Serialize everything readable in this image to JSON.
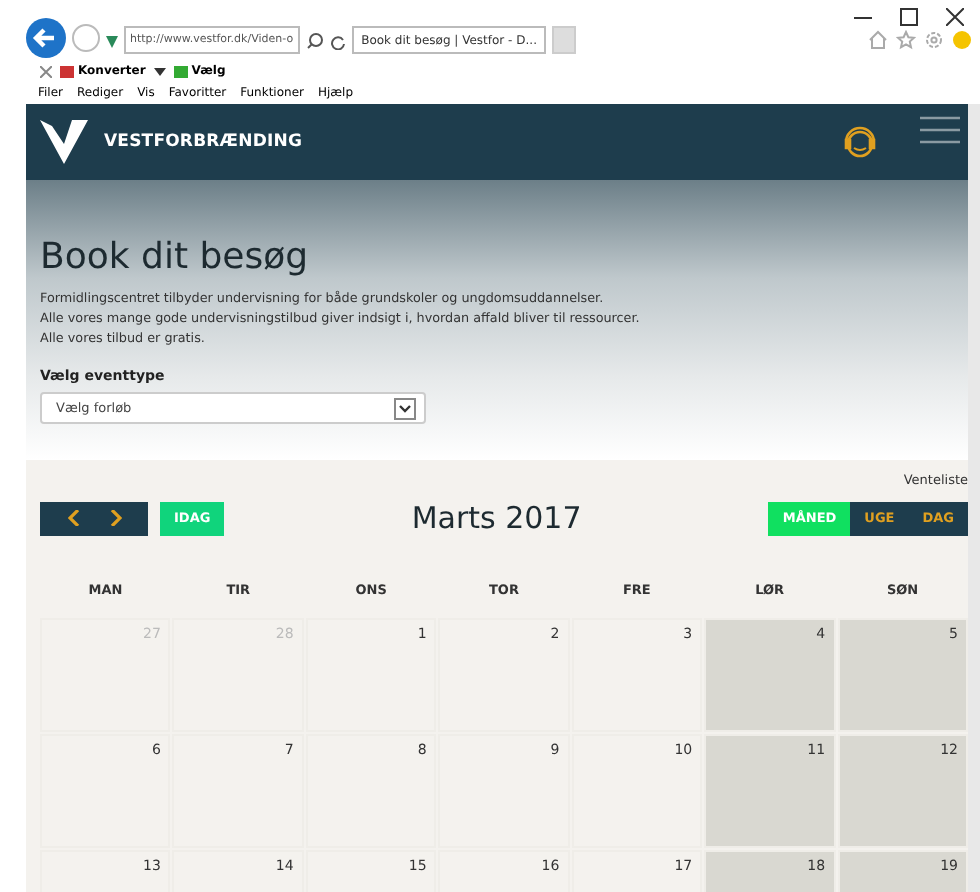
{
  "browser": {
    "address": "http://www.vestfor.dk/Viden-o",
    "tabs": [
      {
        "label": "Book dit besøg | Vestfor - D...",
        "selected": true
      }
    ],
    "toolbar": [
      {
        "label": "Konverter"
      },
      {
        "label": "Vælg"
      }
    ],
    "menu": [
      "Filer",
      "Rediger",
      "Vis",
      "Favoritter",
      "Funktioner",
      "Hjælp"
    ]
  },
  "header": {
    "brand": "VESTFORBRÆNDING"
  },
  "hero": {
    "title": "Book dit besøg",
    "lines": [
      "Formidlingscentret tilbyder undervisning for både grundskoler og ungdomsuddannelser.",
      "Alle vores mange gode undervisningstilbud giver indsigt i, hvordan affald bliver til ressourcer.",
      "Alle vores tilbud er gratis."
    ]
  },
  "filter": {
    "label": "Vælg eventtype",
    "value": "Vælg forløb"
  },
  "calendar": {
    "waitlist": "Venteliste",
    "today": "IDAG",
    "title": "Marts 2017",
    "views": [
      {
        "label": "MÅNED",
        "selected": true
      },
      {
        "label": "UGE",
        "selected": false
      },
      {
        "label": "DAG",
        "selected": false
      }
    ],
    "columns": [
      {
        "label": "MAN",
        "weekend": false
      },
      {
        "label": "TIR",
        "weekend": false
      },
      {
        "label": "ONS",
        "weekend": false
      },
      {
        "label": "TOR",
        "weekend": false
      },
      {
        "label": "FRE",
        "weekend": false
      },
      {
        "label": "LØR",
        "weekend": true
      },
      {
        "label": "SØN",
        "weekend": true
      }
    ],
    "weeks": [
      [
        {
          "day": "27",
          "outside_month": true
        },
        {
          "day": "28",
          "outside_month": true
        },
        {
          "day": "1",
          "outside_month": false
        },
        {
          "day": "2",
          "outside_month": false
        },
        {
          "day": "3",
          "outside_month": false
        },
        {
          "day": "4",
          "outside_month": false
        },
        {
          "day": "5",
          "outside_month": false
        }
      ],
      [
        {
          "day": "6",
          "outside_month": false
        },
        {
          "day": "7",
          "outside_month": false
        },
        {
          "day": "8",
          "outside_month": false
        },
        {
          "day": "9",
          "outside_month": false
        },
        {
          "day": "10",
          "outside_month": false
        },
        {
          "day": "11",
          "outside_month": false
        },
        {
          "day": "12",
          "outside_month": false
        }
      ],
      [
        {
          "day": "13",
          "outside_month": false
        },
        {
          "day": "14",
          "outside_month": false
        },
        {
          "day": "15",
          "outside_month": false
        },
        {
          "day": "16",
          "outside_month": false
        },
        {
          "day": "17",
          "outside_month": false
        },
        {
          "day": "18",
          "outside_month": false
        },
        {
          "day": "19",
          "outside_month": false
        }
      ]
    ]
  }
}
